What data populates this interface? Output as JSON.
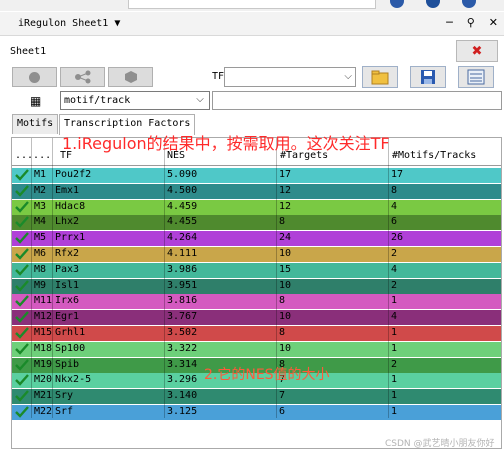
{
  "window": {
    "title": "iRegulon Sheet1 ▼"
  },
  "sheet": {
    "label": "Sheet1"
  },
  "toolbar": {
    "tf_label": "TF",
    "tf_value": ""
  },
  "motif_select": {
    "value": "motif/track"
  },
  "search": {
    "value": ""
  },
  "tabs": [
    {
      "label": "Motifs"
    },
    {
      "label": "Transcription Factors"
    }
  ],
  "annotations": {
    "top": "1.iRegulon的结果中，按需取用。这次关注TF",
    "middle": "2.它的NES值的大小"
  },
  "table": {
    "columns": [
      "......",
      "TF",
      "NES",
      "#Targets",
      "#Motifs/Tracks"
    ],
    "rows": [
      {
        "rank": "M1",
        "tf": "Pou2f2",
        "nes": "5.090",
        "targets": "17",
        "motifs": "17",
        "color": "#4fc8c8"
      },
      {
        "rank": "M2",
        "tf": "Emx1",
        "nes": "4.500",
        "targets": "12",
        "motifs": "8",
        "color": "#2e8b8b"
      },
      {
        "rank": "M3",
        "tf": "Hdac8",
        "nes": "4.459",
        "targets": "12",
        "motifs": "4",
        "color": "#7ac943"
      },
      {
        "rank": "M4",
        "tf": "Lhx2",
        "nes": "4.455",
        "targets": "8",
        "motifs": "6",
        "color": "#4f8a2e"
      },
      {
        "rank": "M5",
        "tf": "Prrx1",
        "nes": "4.264",
        "targets": "24",
        "motifs": "26",
        "color": "#b040d8"
      },
      {
        "rank": "M6",
        "tf": "Rfx2",
        "nes": "4.111",
        "targets": "10",
        "motifs": "2",
        "color": "#c9a64a"
      },
      {
        "rank": "M8",
        "tf": "Pax3",
        "nes": "3.986",
        "targets": "15",
        "motifs": "4",
        "color": "#43b89a"
      },
      {
        "rank": "M9",
        "tf": "Isl1",
        "nes": "3.951",
        "targets": "10",
        "motifs": "2",
        "color": "#2f7f6a"
      },
      {
        "rank": "M11",
        "tf": "Irx6",
        "nes": "3.816",
        "targets": "8",
        "motifs": "1",
        "color": "#d45ac0"
      },
      {
        "rank": "M12",
        "tf": "Egr1",
        "nes": "3.767",
        "targets": "10",
        "motifs": "4",
        "color": "#8a2f7a"
      },
      {
        "rank": "M15",
        "tf": "Grhl1",
        "nes": "3.502",
        "targets": "8",
        "motifs": "1",
        "color": "#d04a4a"
      },
      {
        "rank": "M18",
        "tf": "Sp100",
        "nes": "3.322",
        "targets": "10",
        "motifs": "1",
        "color": "#6ed07a"
      },
      {
        "rank": "M19",
        "tf": "Spib",
        "nes": "3.314",
        "targets": "8",
        "motifs": "2",
        "color": "#3f9a48"
      },
      {
        "rank": "M20",
        "tf": "Nkx2-5",
        "nes": "3.296",
        "targets": "7",
        "motifs": "1",
        "color": "#5ad0a0"
      },
      {
        "rank": "M21",
        "tf": "Sry",
        "nes": "3.140",
        "targets": "7",
        "motifs": "1",
        "color": "#2f8a70"
      },
      {
        "rank": "M22",
        "tf": "Srf",
        "nes": "3.125",
        "targets": "6",
        "motifs": "1",
        "color": "#4aa0d8"
      }
    ]
  },
  "watermark": "CSDN @武艺晴小朋友你好"
}
